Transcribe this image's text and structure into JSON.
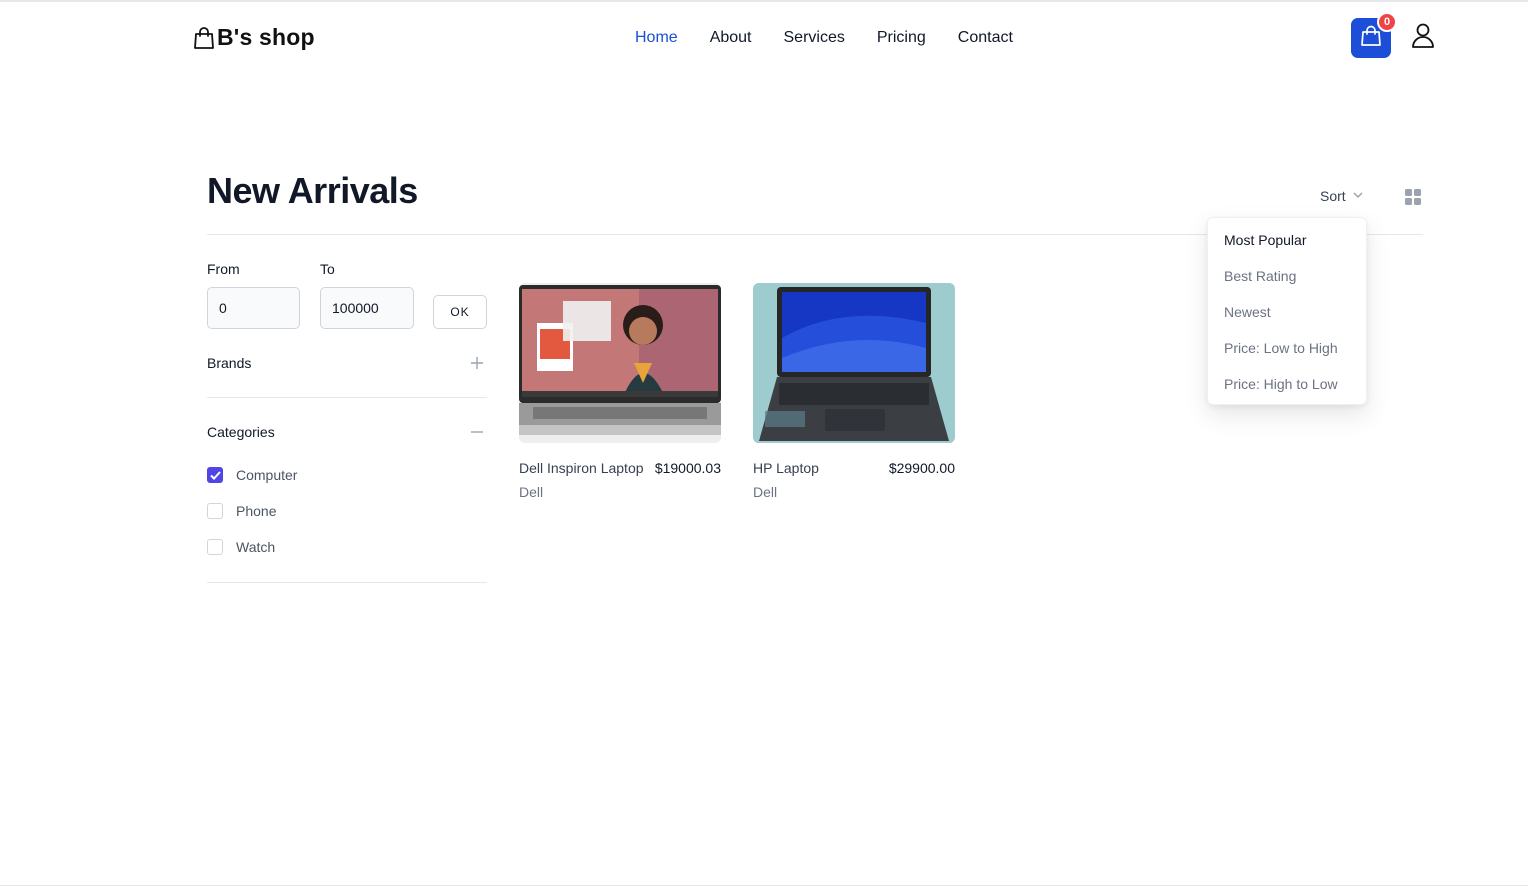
{
  "header": {
    "logo_text": "B's shop",
    "nav": [
      "Home",
      "About",
      "Services",
      "Pricing",
      "Contact"
    ],
    "active_nav": "Home",
    "cart_count": "0",
    "accent_color": "#1d4ed8",
    "badge_color": "#ef4444"
  },
  "page": {
    "title": "New Arrivals",
    "sort_label": "Sort",
    "sort_options": [
      "Most Popular",
      "Best Rating",
      "Newest",
      "Price: Low to High",
      "Price: High to Low"
    ],
    "sort_selected": "Most Popular"
  },
  "filters": {
    "from_label": "From",
    "to_label": "To",
    "from_value": "0",
    "to_value": "100000",
    "ok_label": "OK",
    "brands_title": "Brands",
    "categories_title": "Categories",
    "categories": [
      {
        "label": "Computer",
        "checked": true
      },
      {
        "label": "Phone",
        "checked": false
      },
      {
        "label": "Watch",
        "checked": false
      }
    ],
    "checkbox_color": "#4f46e5"
  },
  "products": [
    {
      "name": "Dell Inspiron Laptop",
      "price": "$19000.03",
      "brand": "Dell"
    },
    {
      "name": "HP Laptop",
      "price": "$29900.00",
      "brand": "Dell"
    }
  ]
}
